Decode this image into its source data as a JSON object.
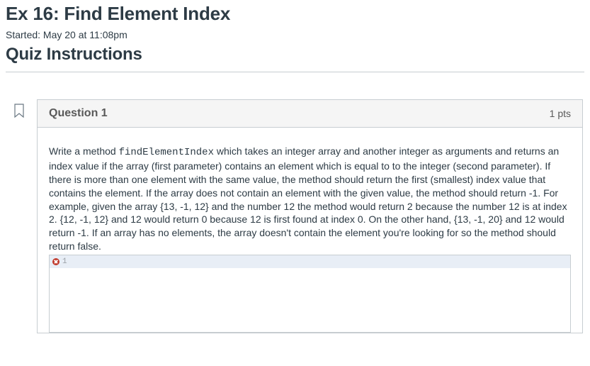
{
  "page": {
    "title": "Ex 16: Find Element Index",
    "started": "Started: May 20 at 11:08pm",
    "instructions_heading": "Quiz Instructions"
  },
  "question": {
    "header": {
      "title": "Question 1",
      "points": "1 pts"
    },
    "prompt": {
      "before_code": "Write a method ",
      "code": "findElementIndex",
      "after_code": " which takes an integer array and another integer as arguments and returns an index value if the array (first parameter) contains an element which is equal to to the integer (second parameter). If there is more than one element with the same value, the method should return the first (smallest) index value that contains the element. If the array does not contain an element with the given value, the method should return -1. For example, given the array {13, -1, 12} and the number 12 the method would return 2 because the number 12 is at index 2. {12, -1, 12} and 12 would return 0 because 12 is first found at index 0. On the other hand, {13, -1, 20} and 12 would return -1. If an array has no elements, the array doesn't contain the element you're looking for so the method should return false."
    },
    "editor": {
      "line_number": "1"
    }
  }
}
